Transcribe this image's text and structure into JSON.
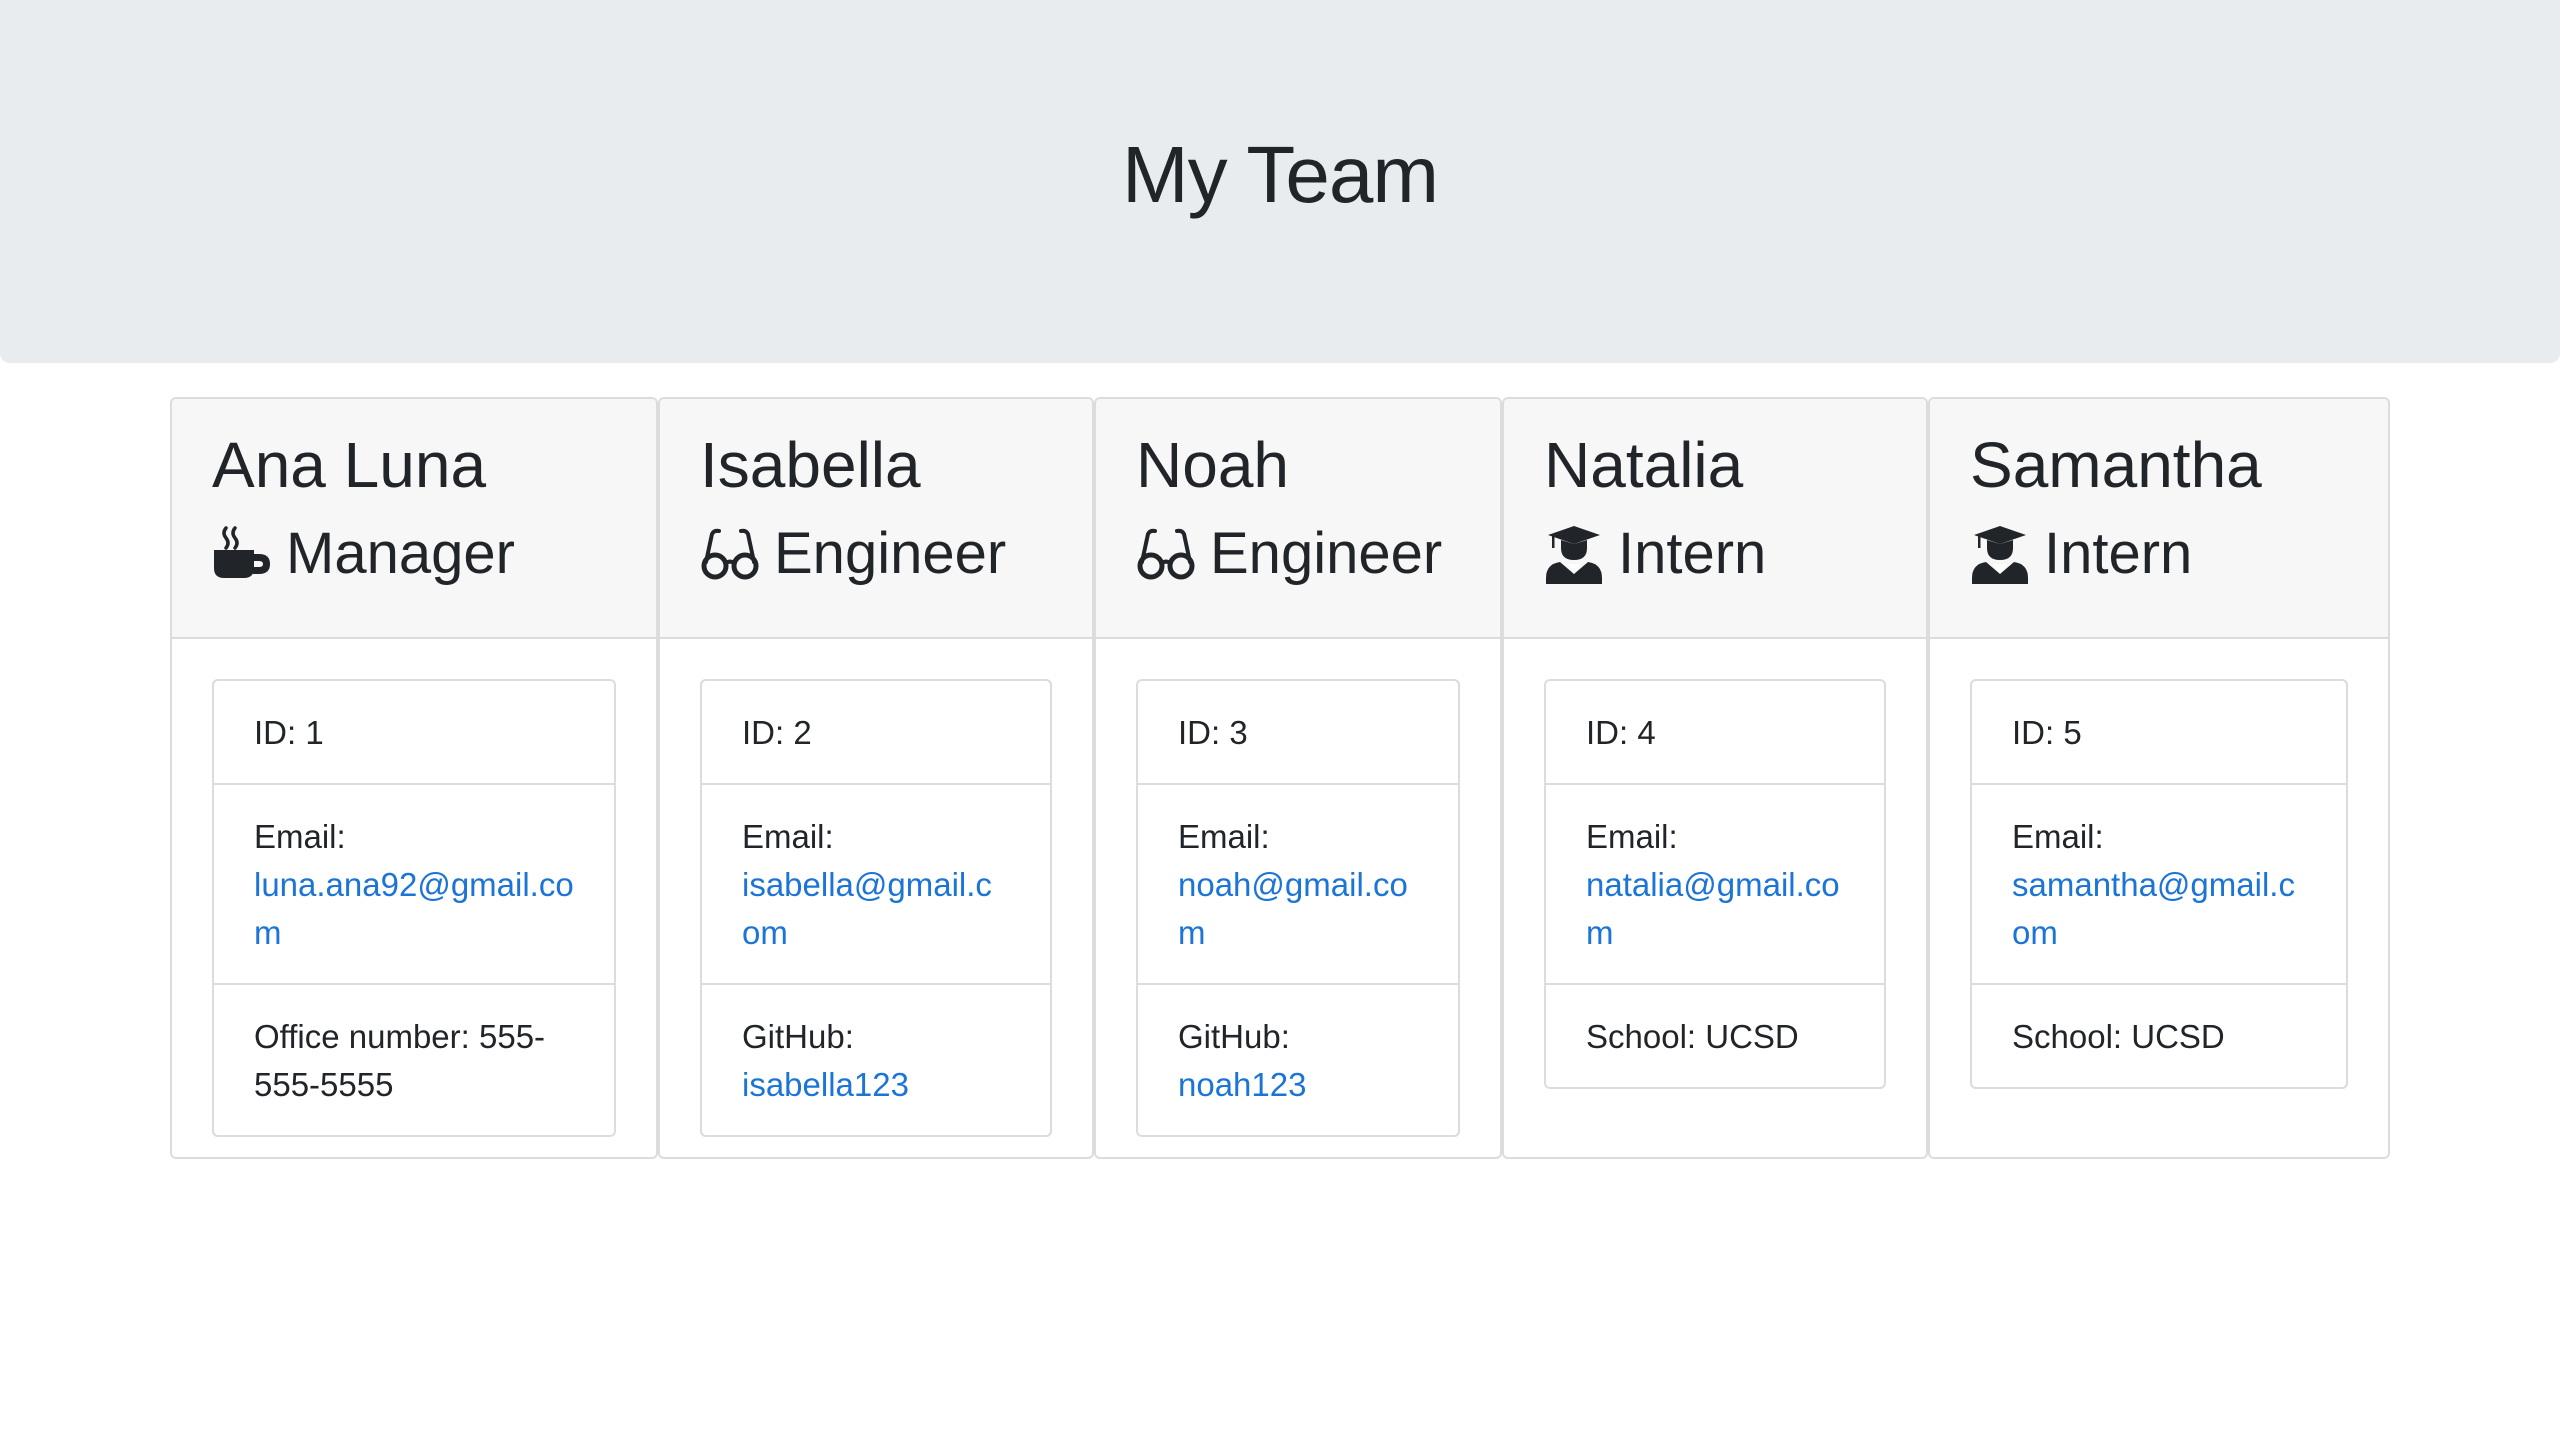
{
  "header": {
    "title": "My Team"
  },
  "colors": {
    "link": "#1b74d6",
    "header_bg": "#e9ecef",
    "card_header_bg": "#f7f7f7"
  },
  "cards": [
    {
      "name": "Ana Luna",
      "role": "Manager",
      "icon": "coffee-mug-icon",
      "id_text": "ID: 1",
      "email_label": "Email:",
      "email": "luna.ana92@gmail.com",
      "extra_label": "Office number: 555-555-5555",
      "extra_value": ""
    },
    {
      "name": "Isabella",
      "role": "Engineer",
      "icon": "glasses-icon",
      "id_text": "ID: 2",
      "email_label": "Email:",
      "email": "isabella@gmail.com",
      "extra_label": "GitHub:",
      "extra_value": "isabella123"
    },
    {
      "name": "Noah",
      "role": "Engineer",
      "icon": "glasses-icon",
      "id_text": "ID: 3",
      "email_label": "Email:",
      "email": "noah@gmail.com",
      "extra_label": "GitHub:",
      "extra_value": "noah123"
    },
    {
      "name": "Natalia",
      "role": "Intern",
      "icon": "graduate-icon",
      "id_text": "ID: 4",
      "email_label": "Email:",
      "email": "natalia@gmail.com",
      "extra_label": "School: UCSD",
      "extra_value": ""
    },
    {
      "name": "Samantha",
      "role": "Intern",
      "icon": "graduate-icon",
      "id_text": "ID: 5",
      "email_label": "Email:",
      "email": "samantha@gmail.com",
      "extra_label": "School: UCSD",
      "extra_value": ""
    }
  ]
}
